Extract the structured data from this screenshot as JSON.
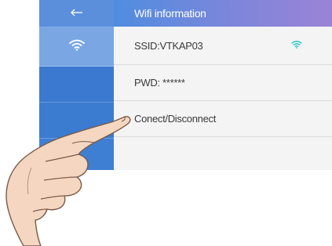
{
  "header": {
    "back_icon": "arrow-left-icon",
    "title": "Wifi information"
  },
  "sidebar": {
    "items": [
      {
        "icon": "arrow-left-icon"
      },
      {
        "icon": "wifi-icon",
        "active": true
      },
      {},
      {}
    ]
  },
  "wifi": {
    "ssid_label": "SSID:VTKAP03",
    "signal_icon": "wifi-signal-icon",
    "password_label": "PWD: ******",
    "connect_label": "Conect/Disconnect"
  },
  "colors": {
    "sidebar": "#3f7fd3",
    "sidebar_active": "#7aa6e4",
    "header_start": "#4f8de0",
    "header_end": "#9b83d6",
    "content_bg": "#f4f4f4",
    "signal": "#27c7c0"
  }
}
